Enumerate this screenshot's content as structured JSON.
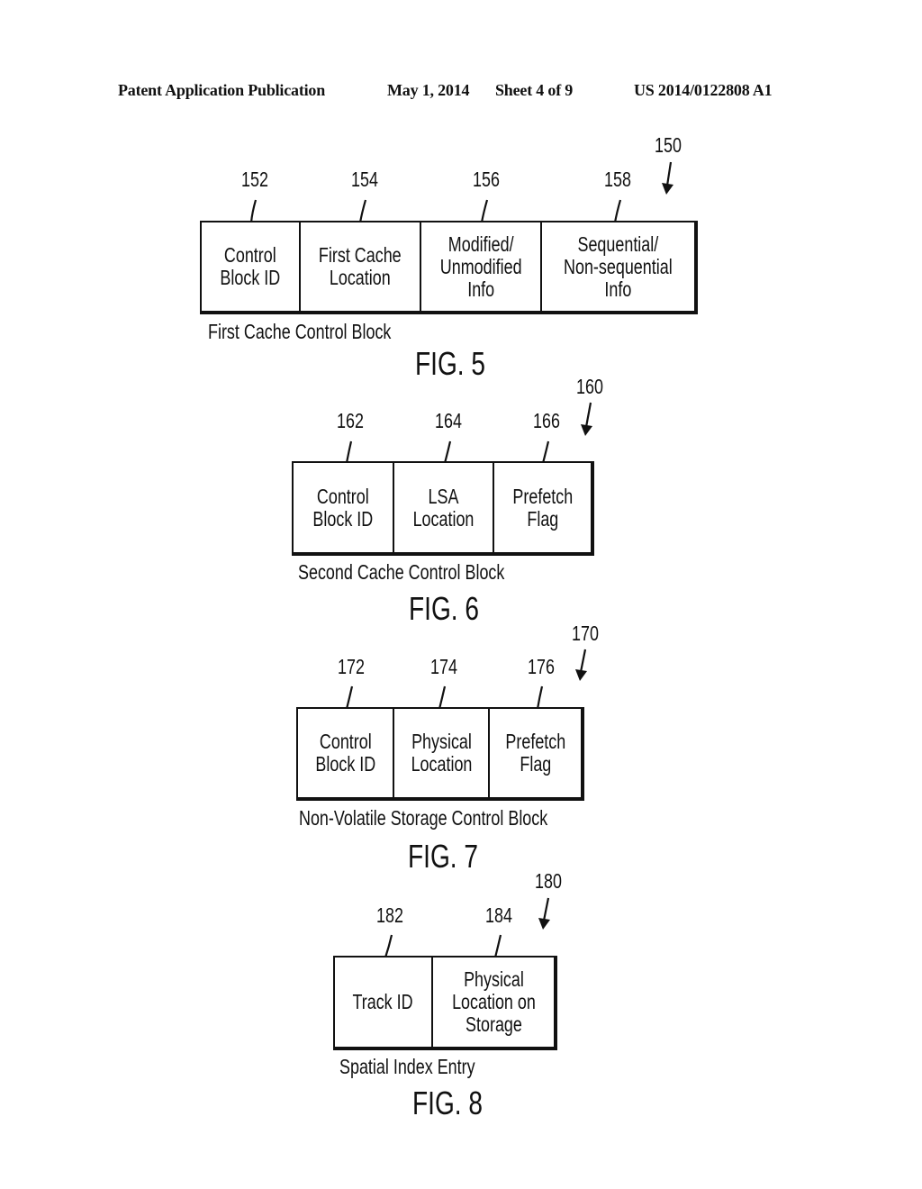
{
  "header": {
    "publication": "Patent Application Publication",
    "date": "May 1, 2014",
    "sheet": "Sheet 4 of 9",
    "number": "US 2014/0122808 A1"
  },
  "figures": [
    {
      "id": "fig5",
      "figure_label": "FIG. 5",
      "block_ref": "150",
      "caption": "First Cache Control Block",
      "fields": [
        {
          "ref": "152",
          "label": "Control\nBlock ID"
        },
        {
          "ref": "154",
          "label": "First Cache\nLocation"
        },
        {
          "ref": "156",
          "label": "Modified/\nUnmodified\nInfo"
        },
        {
          "ref": "158",
          "label": "Sequential/\nNon-sequential\nInfo"
        }
      ]
    },
    {
      "id": "fig6",
      "figure_label": "FIG. 6",
      "block_ref": "160",
      "caption": "Second Cache Control Block",
      "fields": [
        {
          "ref": "162",
          "label": "Control\nBlock ID"
        },
        {
          "ref": "164",
          "label": "LSA\nLocation"
        },
        {
          "ref": "166",
          "label": "Prefetch\nFlag"
        }
      ]
    },
    {
      "id": "fig7",
      "figure_label": "FIG. 7",
      "block_ref": "170",
      "caption": "Non-Volatile Storage Control Block",
      "fields": [
        {
          "ref": "172",
          "label": "Control\nBlock ID"
        },
        {
          "ref": "174",
          "label": "Physical\nLocation"
        },
        {
          "ref": "176",
          "label": "Prefetch\nFlag"
        }
      ]
    },
    {
      "id": "fig8",
      "figure_label": "FIG. 8",
      "block_ref": "180",
      "caption": "Spatial Index Entry",
      "fields": [
        {
          "ref": "182",
          "label": "Track ID"
        },
        {
          "ref": "184",
          "label": "Physical\nLocation on\nStorage"
        }
      ]
    }
  ]
}
